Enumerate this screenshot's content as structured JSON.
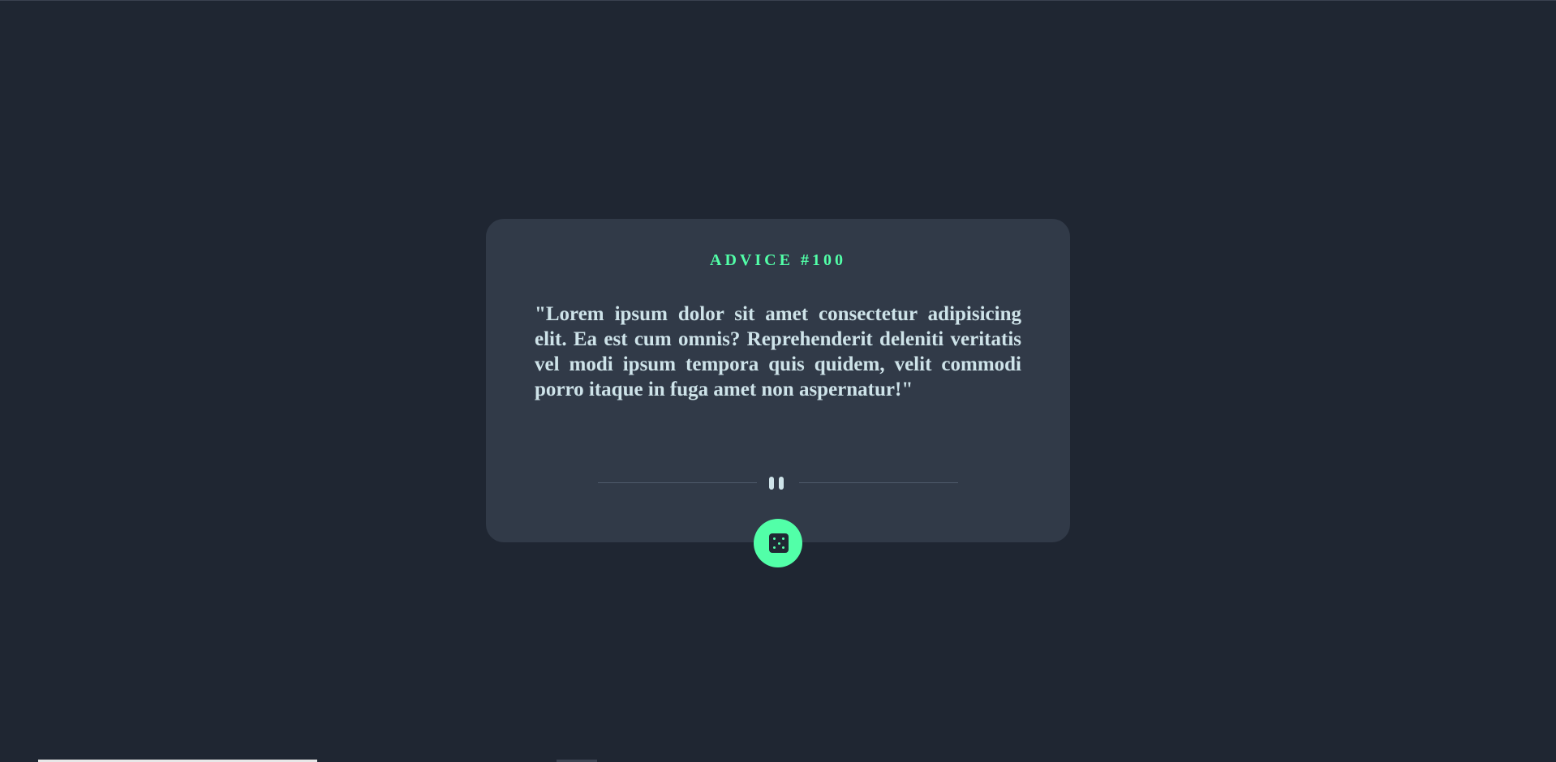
{
  "advice": {
    "id_label": "ADVICE #100",
    "quote": "\"Lorem ipsum dolor sit amet consectetur adipisicing elit. Ea est cum omnis? Reprehenderit deleniti veritatis vel modi ipsum tempora quis quidem, velit commodi porro itaque in fuga amet non aspernatur!\""
  },
  "divider": {
    "icon": "pause-icon"
  },
  "generate_button": {
    "icon": "dice-icon"
  },
  "colors": {
    "background": "#1f2632",
    "card": "#313a48",
    "accent": "#52ffa8",
    "text": "#cee3e9"
  }
}
